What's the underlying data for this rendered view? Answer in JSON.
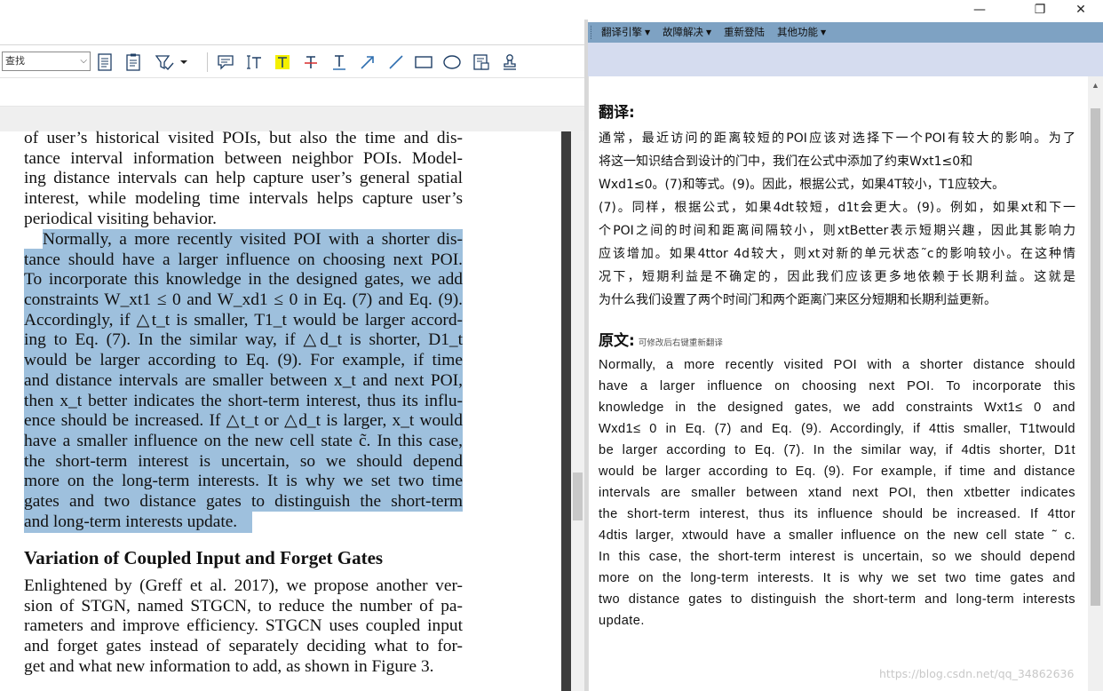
{
  "window": {
    "minimize_glyph": "—",
    "restore_glyph": "❐",
    "close_glyph": "✕"
  },
  "pdf_toolbar": {
    "find_value": "查找",
    "icons": [
      "page-icon",
      "pages-icon",
      "select-tool-icon",
      "comment-icon",
      "text-edit-icon",
      "highlight-icon",
      "strikethrough-icon",
      "underline-icon",
      "arrow-icon",
      "line-icon",
      "rectangle-icon",
      "ellipse-icon",
      "stamp-icon",
      "signature-icon"
    ]
  },
  "pdf": {
    "intro_lines": [
      "of user’s historical visited POIs, but also the time and dis-",
      "tance interval information between neighbor POIs. Model-",
      "ing distance intervals can help capture user’s general spatial",
      "interest, while modeling time intervals helps capture user’s",
      "periodical visiting behavior."
    ],
    "selected_lines": [
      "Normally, a more recently visited POI with a shorter dis-",
      "tance should have a larger influence on choosing next POI.",
      "To incorporate this knowledge in the designed gates, we add",
      "constraints W_xt1 ≤ 0 and W_xd1 ≤ 0 in Eq. (7) and Eq. (9).",
      "Accordingly, if △t_t is smaller, T1_t would be larger accord-",
      "ing to Eq. (7). In the similar way, if △d_t is shorter, D1_t",
      "would be larger according to Eq. (9). For example, if time",
      "and distance intervals are smaller between x_t and next POI,",
      "then x_t better indicates the short-term interest, thus its influ-",
      "ence should be increased. If △t_t or △d_t is larger, x_t would",
      "have a smaller influence on the new cell state c̃. In this case,",
      "the short-term interest is uncertain, so we should depend",
      "more on the long-term interests. It is why we set two time",
      "gates and two distance gates to distinguish the short-term",
      "and long-term interests update."
    ],
    "section_heading": "Variation of Coupled Input and Forget Gates",
    "section_lines": [
      "Enlightened by (Greff et al. 2017), we propose another ver-",
      "sion of STGN, named STGCN, to reduce the number of pa-",
      "rameters and improve efficiency. STGCN uses coupled input",
      "and forget gates instead of separately deciding what to for-",
      "get and what new information to add, as shown in Figure 3."
    ]
  },
  "translator": {
    "menu": [
      {
        "label": "翻译引擎",
        "has_caret": true
      },
      {
        "label": "故障解决",
        "has_caret": true
      },
      {
        "label": "重新登陆",
        "has_caret": false
      },
      {
        "label": "其他功能",
        "has_caret": true
      }
    ],
    "translation_title": "翻译:",
    "translation_lines": [
      "通常，最近访问的距离较短的POI应该对选择下一个POI有较大的影响。为了",
      "将这一知识结合到设计的门中，我们在公式中添加了约束Wxt1≤0和",
      "Wxd1≤0。(7)和等式。(9)。因此，根据公式，如果4T较小，T1应较大。",
      "(7)。同样，根据公式，如果4dt较短，d1t会更大。(9)。例如，如果xt和下一",
      "个POI之间的时间和距离间隔较小，则xtBetter表示短期兴趣，因此其影响力",
      "应该增加。如果4ttor  4d较大，则xt对新的单元状态˜c的影响较小。在这种情",
      "况下，短期利益是不确定的，因此我们应该更多地依赖于长期利益。这就是",
      "为什么我们设置了两个时间门和两个距离门来区分短期和长期利益更新。"
    ],
    "original_title": "原文:",
    "original_hint": "可修改后右键重新翻译",
    "original_lines": [
      "Normally, a more recently visited POI with a shorter distance should",
      "have a larger influence on choosing next POI. To incorporate this",
      "knowledge in the designed gates, we add constraints Wxt1≤ 0 and",
      "Wxd1≤ 0 in Eq. (7) and Eq. (9). Accordingly, if 4ttis smaller, T1twould",
      "be larger according to Eq. (7). In the similar way, if 4dtis shorter, D1t",
      "would be larger according to Eq. (9). For example, if time and distance",
      "intervals are smaller between xtand next POI, then xtbetter indicates",
      "the short-term interest, thus its influence should be increased. If 4ttor",
      "4dtis larger, xtwould have a smaller influence on the new cell state ˜ c.",
      "In this case, the short-term interest is uncertain, so we should depend",
      "more on the long-term interests. It is why we set two time gates and",
      "two distance gates to distinguish the short-term and long-term interests",
      "update."
    ]
  },
  "watermark": "https://blog.csdn.net/qq_34862636"
}
